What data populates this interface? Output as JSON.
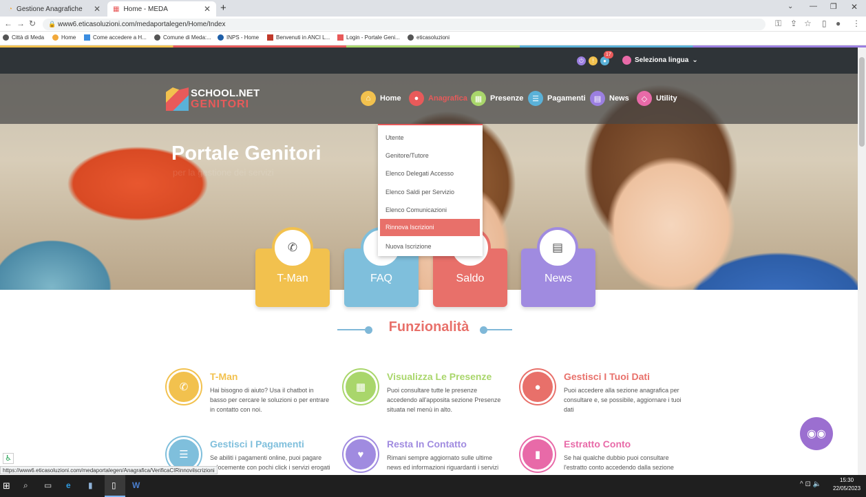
{
  "tabs": [
    {
      "label": "Gestione Anagrafiche"
    },
    {
      "label": "Home - MEDA"
    }
  ],
  "address": {
    "url": "www6.eticasoluzioni.com/medaportalegen/Home/Index"
  },
  "bookmarks": [
    "Città di Meda",
    "Home",
    "Come accedere a H...",
    "Comune di Meda:...",
    "INPS - Home",
    "Benvenuti in ANCI L...",
    "Login - Portale Geni...",
    "eticasoluzioni"
  ],
  "topbar": {
    "badge": "17",
    "language": "Seleziona lingua"
  },
  "logo": {
    "line1": "SCHOOL.NET",
    "line2": "GENITORI"
  },
  "menu": [
    {
      "label": "Home",
      "icon": "home-icon",
      "color": "#f2c14e"
    },
    {
      "label": "Anagrafica",
      "icon": "user-icon",
      "color": "#e85a5a"
    },
    {
      "label": "Presenze",
      "icon": "calendar-icon",
      "color": "#a9d66b"
    },
    {
      "label": "Pagamenti",
      "icon": "list-icon",
      "color": "#5ab1d8"
    },
    {
      "label": "News",
      "icon": "newspaper-icon",
      "color": "#9b7fe0"
    },
    {
      "label": "Utility",
      "icon": "diamond-icon",
      "color": "#e86aa8"
    }
  ],
  "dropdown": [
    "Utente",
    "Genitore/Tutore",
    "Elenco Delegati Accesso",
    "Elenco Saldi per Servizio",
    "Elenco Comunicazioni",
    "Rinnova Iscrizioni",
    "Nuova Iscrizione"
  ],
  "hero": {
    "title": "Portale Genitori",
    "subtitle": "per la gestione dei servizi"
  },
  "cards": [
    {
      "label": "T-Man",
      "color": "#f2c14e",
      "icon": "phone-icon"
    },
    {
      "label": "FAQ",
      "color": "#7fbfdc",
      "icon": "question-icon"
    },
    {
      "label": "Saldo",
      "color": "#e8706a",
      "icon": "euro-icon"
    },
    {
      "label": "News",
      "color": "#a08be0",
      "icon": "newspaper-icon"
    }
  ],
  "section_title": "Funzionalità",
  "features": [
    {
      "title": "T-Man",
      "text": "Hai bisogno di aiuto? Usa il chatbot in basso per cercare le soluzioni o per entrare in contatto con noi.",
      "color": "#f2c14e"
    },
    {
      "title": "Visualizza Le Presenze",
      "text": "Puoi consultare tutte le presenze accedendo all'apposita sezione Presenze situata nel menù in alto.",
      "color": "#a9d66b"
    },
    {
      "title": "Gestisci I Tuoi Dati",
      "text": "Puoi accedere alla sezione anagrafica per consultare e, se possibile, aggiornare i tuoi dati",
      "color": "#e8706a"
    },
    {
      "title": "Gestisci I Pagamenti",
      "text": "Se abiliti i pagamenti online, puoi pagare velocemente con pochi click i servizi erogati",
      "color": "#7fbfdc"
    },
    {
      "title": "Resta In Contatto",
      "text": "Rimani sempre aggiornato sulle ultime news ed informazioni riguardanti i servizi",
      "color": "#a08be0"
    },
    {
      "title": "Estratto Conto",
      "text": "Se hai qualche dubbio puoi consultare l'estratto conto accedendo dalla sezione",
      "color": "#e86aa8"
    }
  ],
  "status_url": "https://www6.eticasoluzioni.com/medaportalegen/Anagrafica/VerificaCIRinnovilscrizioni",
  "taskbar": {
    "time": "15:30",
    "date": "22/05/2023"
  }
}
